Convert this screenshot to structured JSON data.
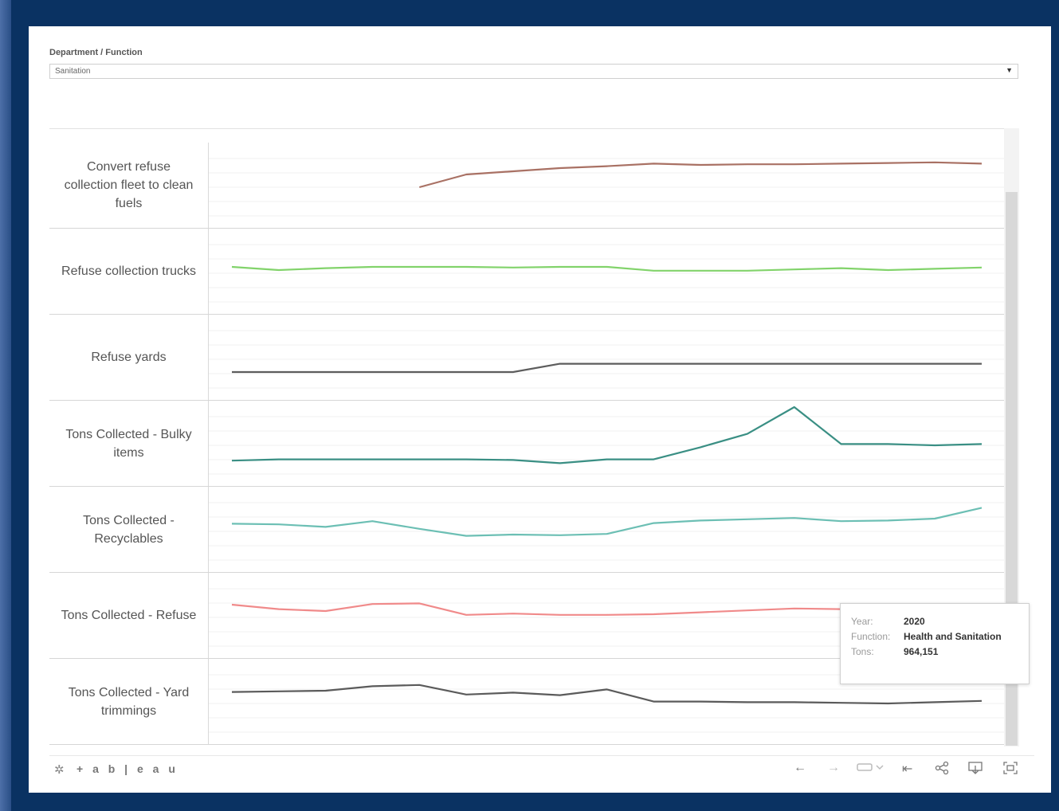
{
  "filter": {
    "label": "Department / Function",
    "selected_value": "Sanitation"
  },
  "rows": [
    {
      "label": "Convert refuse collection fleet to clean fuels",
      "color": "#a97164"
    },
    {
      "label": "Refuse collection trucks",
      "color": "#82d36b"
    },
    {
      "label": "Refuse yards",
      "color": "#5d5d5d"
    },
    {
      "label": "Tons Collected - Bulky items",
      "color": "#3a8f84"
    },
    {
      "label": "Tons Collected - Recyclables",
      "color": "#6cbfb4"
    },
    {
      "label": "Tons Collected - Refuse",
      "color": "#f08a8a"
    },
    {
      "label": "Tons Collected - Yard trimmings",
      "color": "#5b5b5b"
    }
  ],
  "chart_data": {
    "type": "line",
    "x_points": 17,
    "series": [
      {
        "name": "Convert refuse collection fleet to clean fuels",
        "values": [
          null,
          null,
          null,
          null,
          40,
          60,
          65,
          70,
          73,
          77,
          75,
          76,
          76,
          77,
          78,
          79,
          77
        ]
      },
      {
        "name": "Refuse collection trucks",
        "values": [
          50,
          45,
          48,
          50,
          50,
          50,
          49,
          50,
          50,
          44,
          44,
          44,
          46,
          48,
          45,
          47,
          49
        ]
      },
      {
        "name": "Refuse yards",
        "values": [
          20,
          20,
          20,
          20,
          20,
          20,
          20,
          33,
          33,
          33,
          33,
          33,
          33,
          33,
          33,
          33,
          33
        ]
      },
      {
        "name": "Tons Collected - Bulky items",
        "values": [
          16,
          18,
          18,
          18,
          18,
          18,
          17,
          12,
          18,
          18,
          37,
          58,
          100,
          42,
          42,
          40,
          42
        ]
      },
      {
        "name": "Tons Collected - Recyclables",
        "values": [
          52,
          51,
          47,
          56,
          44,
          33,
          35,
          34,
          36,
          53,
          57,
          59,
          61,
          56,
          57,
          60,
          77
        ]
      },
      {
        "name": "Tons Collected - Refuse",
        "values": [
          60,
          53,
          50,
          61,
          62,
          44,
          46,
          44,
          44,
          45,
          48,
          51,
          54,
          53,
          53,
          55,
          59
        ]
      },
      {
        "name": "Tons Collected - Yard trimmings",
        "values": [
          58,
          59,
          60,
          67,
          69,
          54,
          57,
          53,
          62,
          43,
          43,
          42,
          42,
          41,
          40,
          42,
          44
        ]
      }
    ]
  },
  "tooltip": {
    "year_key": "Year:",
    "year_value": "2020",
    "function_key": "Function:",
    "function_value": "Health and Sanitation",
    "tons_key": "Tons:",
    "tons_value": "964,151"
  },
  "toolbar": {
    "logo_text": "+ a b | e a u",
    "undo": "←",
    "redo": "→",
    "revert": "⇤",
    "share": "share",
    "download": "download",
    "fullscreen": "fullscreen"
  }
}
